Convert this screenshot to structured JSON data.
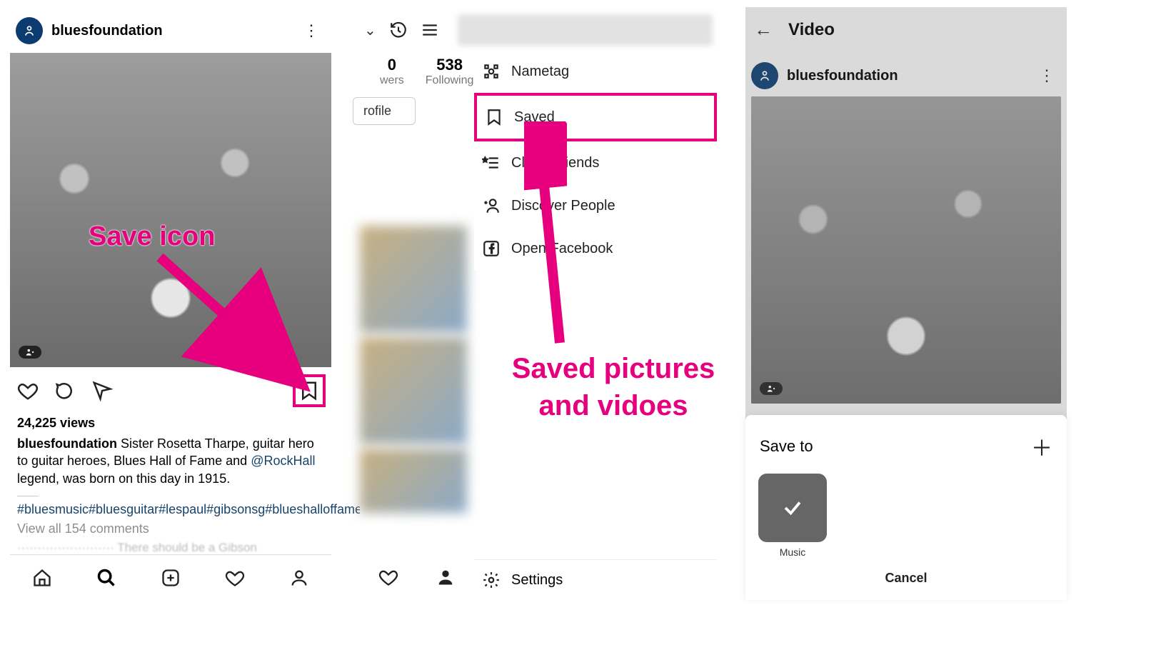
{
  "colors": {
    "accent": "#e6007e",
    "link": "#17436b"
  },
  "panel1": {
    "username": "bluesfoundation",
    "views": "24,225 views",
    "caption_user": "bluesfoundation",
    "caption_text_1": " Sister Rosetta Tharpe, guitar hero to guitar heroes, Blues Hall of Fame and ",
    "caption_mention": "@RockHall",
    "caption_text_2": " legend, was born on this day in 1915.",
    "hashtags": "#bluesmusic#bluesguitar#lespaul#gibsonsg#blueshalloffame#sisterrosettatharpe",
    "view_all": "View all 154 comments",
    "annot": "Save icon"
  },
  "panel2": {
    "stats": {
      "count1": "0",
      "label1": "wers",
      "count2": "538",
      "label2": "Following"
    },
    "edit": "rofile",
    "menu": {
      "nametag": "Nametag",
      "saved": "Saved",
      "close": "Close Friends",
      "discover": "Discover People",
      "facebook": "Open Facebook"
    },
    "settings": "Settings",
    "annot": "Saved pictures and vidoes"
  },
  "panel3": {
    "title": "Video",
    "username": "bluesfoundation",
    "save_to": "Save to",
    "collection": "Music",
    "cancel": "Cancel"
  }
}
